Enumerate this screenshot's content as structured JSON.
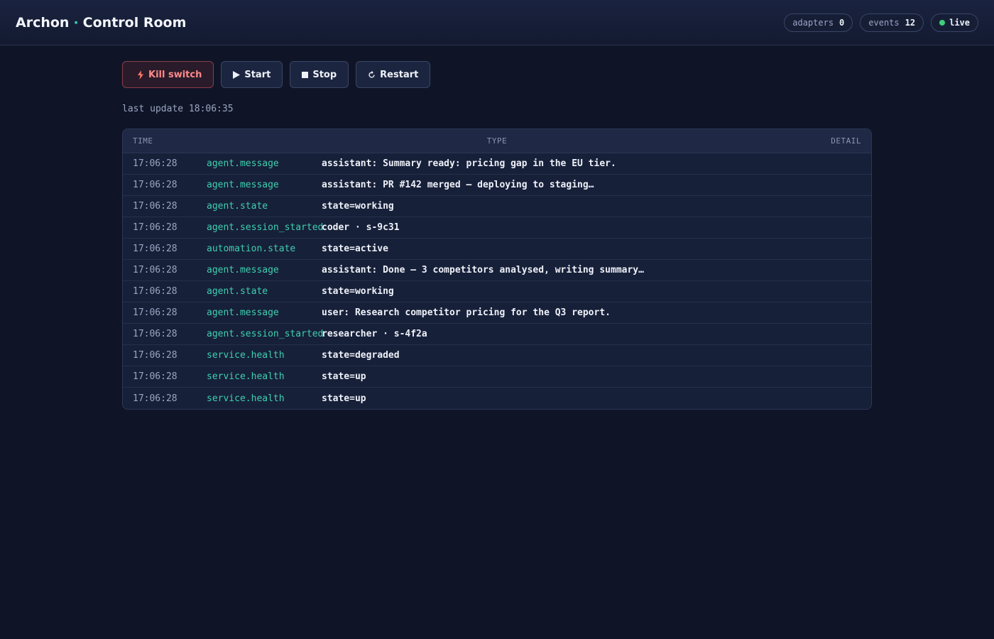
{
  "header": {
    "title_left": "Archon",
    "title_sep": "·",
    "title_right": "Control Room",
    "pills": {
      "adapters_label": "adapters",
      "adapters_value": "0",
      "events_label": "events",
      "events_value": "12",
      "live_label": "live"
    }
  },
  "controls": {
    "kill_label": "Kill switch",
    "start_label": "Start",
    "stop_label": "Stop",
    "restart_label": "Restart"
  },
  "status": {
    "last_update": "last update 18:06:35"
  },
  "table": {
    "headers": {
      "time": "TIME",
      "type": "TYPE",
      "detail": "DETAIL"
    },
    "rows": [
      {
        "time": "17:06:28",
        "type": "agent.message",
        "detail": "assistant: Summary ready: pricing gap in the EU tier."
      },
      {
        "time": "17:06:28",
        "type": "agent.message",
        "detail": "assistant: PR #142 merged — deploying to staging…"
      },
      {
        "time": "17:06:28",
        "type": "agent.state",
        "detail": "state=working"
      },
      {
        "time": "17:06:28",
        "type": "agent.session_started",
        "detail": "coder · s-9c31"
      },
      {
        "time": "17:06:28",
        "type": "automation.state",
        "detail": "state=active"
      },
      {
        "time": "17:06:28",
        "type": "agent.message",
        "detail": "assistant: Done — 3 competitors analysed, writing summary…"
      },
      {
        "time": "17:06:28",
        "type": "agent.state",
        "detail": "state=working"
      },
      {
        "time": "17:06:28",
        "type": "agent.message",
        "detail": "user: Research competitor pricing for the Q3 report."
      },
      {
        "time": "17:06:28",
        "type": "agent.session_started",
        "detail": "researcher · s-4f2a"
      },
      {
        "time": "17:06:28",
        "type": "service.health",
        "detail": "state=degraded"
      },
      {
        "time": "17:06:28",
        "type": "service.health",
        "detail": "state=up"
      },
      {
        "time": "17:06:28",
        "type": "service.health",
        "detail": "state=up"
      }
    ]
  },
  "colors": {
    "background": "#0f1527",
    "accent": "#3ecfb0",
    "danger": "#ff8a8a",
    "live": "#3ecf7a"
  },
  "icons": {
    "kill": "bolt-icon",
    "start": "play-icon",
    "stop": "stop-icon",
    "restart": "restart-icon"
  }
}
